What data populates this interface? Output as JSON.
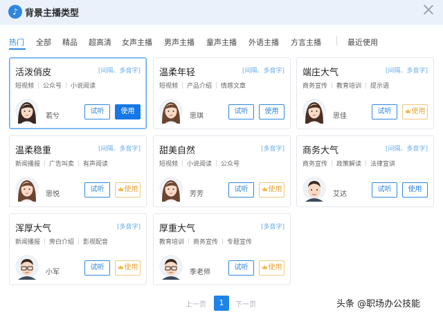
{
  "header": {
    "title": "背景主播类型"
  },
  "tabs": [
    "热门",
    "全部",
    "精品",
    "超高清",
    "女声主播",
    "男声主播",
    "童声主播",
    "外语主播",
    "方言主播",
    "最近使用"
  ],
  "buttons": {
    "listen": "试听",
    "use": "使用"
  },
  "cards": [
    {
      "name": "活泼俏皮",
      "tags": "[间隔、多音字]",
      "cats": [
        "短视频",
        "公众号",
        "小说阅读"
      ],
      "voice": "若兮",
      "use_style": "primary",
      "avatar": "female-1"
    },
    {
      "name": "温柔年轻",
      "tags": "[间隔、多音字]",
      "cats": [
        "短视频",
        "产品介绍",
        "情感文章"
      ],
      "voice": "思琪",
      "use_style": "normal",
      "avatar": "female-2"
    },
    {
      "name": "端庄大气",
      "tags": "[间隔、多音字]",
      "cats": [
        "商务宣传",
        "教育培训",
        "提示语"
      ],
      "voice": "思佳",
      "use_style": "vip",
      "avatar": "female-3"
    },
    {
      "name": "温柔稳重",
      "tags": "[间隔、多音字]",
      "cats": [
        "新闻播报",
        "广告叫卖",
        "有声阅读"
      ],
      "voice": "思悦",
      "use_style": "vip",
      "avatar": "female-2"
    },
    {
      "name": "甜美自然",
      "tags": "[多音字]",
      "cats": [
        "短视频",
        "小说阅读",
        "公众号"
      ],
      "voice": "芳芳",
      "use_style": "vip",
      "avatar": "female-2"
    },
    {
      "name": "商务大气",
      "tags": "[间隔、多音字]",
      "cats": [
        "商务宣传",
        "政策解读",
        "法律宣讲"
      ],
      "voice": "艾达",
      "use_style": "normal",
      "avatar": "male-1"
    },
    {
      "name": "浑厚大气",
      "tags": "[多音字]",
      "cats": [
        "新闻播报",
        "旁白介绍",
        "影视配音"
      ],
      "voice": "小军",
      "use_style": "vip",
      "avatar": "male-2"
    },
    {
      "name": "厚重大气",
      "tags": "[多音字]",
      "cats": [
        "教育培训",
        "商务宣传",
        "专题宣传"
      ],
      "voice": "季老师",
      "use_style": "vip",
      "avatar": "male-2"
    }
  ],
  "pager": {
    "prev": "上一页",
    "current": "1",
    "next": "下一页"
  },
  "watermark": "头条 @职场办公技能",
  "colors": {
    "accent": "#1e84e8",
    "vip": "#e8a53a",
    "tag": "#6aaee8"
  }
}
